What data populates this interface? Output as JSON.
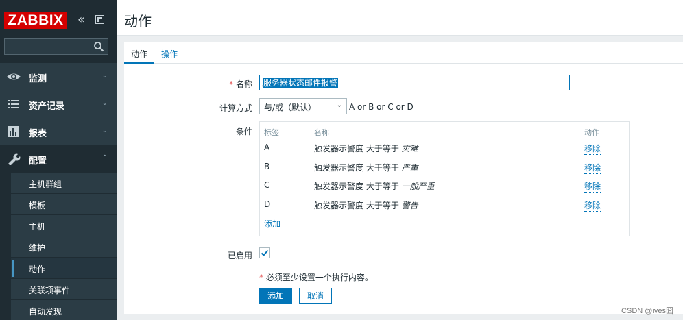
{
  "sidebar": {
    "logo": "ZABBIX",
    "collapse_icon": "«",
    "search": {
      "value": "",
      "placeholder": ""
    },
    "menu": [
      {
        "label": "监测",
        "icon": "eye-icon"
      },
      {
        "label": "资产记录",
        "icon": "list-icon"
      },
      {
        "label": "报表",
        "icon": "bar-chart-icon"
      },
      {
        "label": "配置",
        "icon": "wrench-icon"
      }
    ],
    "submenu": [
      {
        "label": "主机群组"
      },
      {
        "label": "模板"
      },
      {
        "label": "主机"
      },
      {
        "label": "维护"
      },
      {
        "label": "动作"
      },
      {
        "label": "关联项事件"
      },
      {
        "label": "自动发现"
      }
    ],
    "arrow_down": "⌄",
    "arrow_up": "⌃"
  },
  "header": {
    "title": "动作"
  },
  "tabs": [
    {
      "label": "动作"
    },
    {
      "label": "操作"
    }
  ],
  "form": {
    "name_label": "名称",
    "required_mark": "*",
    "name_value": "服务器状态邮件报警",
    "calc_label": "计算方式",
    "calc_value": "与/或（默认）",
    "calc_formula": "A or B or C or D",
    "conditions_label": "条件",
    "conditions_headers": {
      "label": "标签",
      "name": "名称",
      "action": "动作"
    },
    "conditions": [
      {
        "label": "A",
        "name_prefix": "触发器示警度 大于等于 ",
        "name_value": "灾难",
        "action": "移除"
      },
      {
        "label": "B",
        "name_prefix": "触发器示警度 大于等于 ",
        "name_value": "严重",
        "action": "移除"
      },
      {
        "label": "C",
        "name_prefix": "触发器示警度 大于等于 ",
        "name_value": "一般严重",
        "action": "移除"
      },
      {
        "label": "D",
        "name_prefix": "触发器示警度 大于等于 ",
        "name_value": "警告",
        "action": "移除"
      }
    ],
    "add_condition": "添加",
    "enabled_label": "已启用",
    "enabled": true,
    "must_note": "必须至少设置一个执行内容。",
    "add_button": "添加",
    "cancel_button": "取消"
  },
  "watermark": "CSDN @ives囧",
  "colors": {
    "accent": "#0275b8",
    "sidebar": "#1f2c33",
    "brand": "#d40000",
    "required": "#e45959"
  }
}
